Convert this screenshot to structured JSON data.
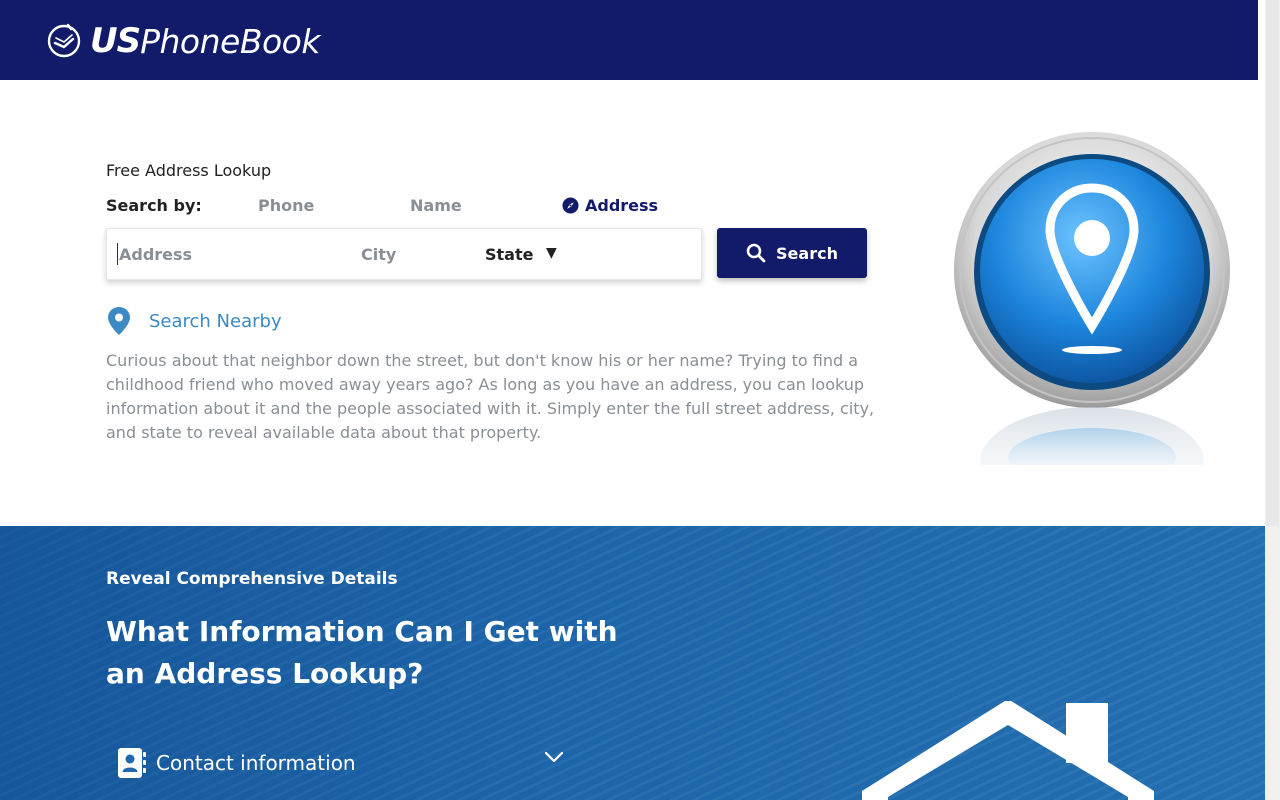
{
  "header": {
    "logo_bold": "US",
    "logo_regular": "PhoneBook"
  },
  "lookup": {
    "kicker": "Free Address Lookup",
    "search_by_label": "Search by:",
    "tabs": [
      {
        "label": "Phone",
        "active": false
      },
      {
        "label": "Name",
        "active": false
      },
      {
        "label": "Address",
        "active": true
      }
    ],
    "address_placeholder": "Address",
    "city_placeholder": "City",
    "state_label": "State",
    "search_button": "Search",
    "nearby_label": "Search Nearby",
    "description": "Curious about that neighbor down the street, but don't know his or her name? Trying to find a childhood friend who moved away years ago? As long as you have an address, you can lookup information about it and the people associated with it. Simply enter the full street address, city, and state to reveal available data about that property."
  },
  "details": {
    "kicker": "Reveal Comprehensive Details",
    "title": "What Information Can I Get with an Address Lookup?",
    "accordion": [
      {
        "label": "Contact information",
        "icon": "contact-card-icon"
      }
    ]
  },
  "colors": {
    "header_bg": "#121a6a",
    "accent_link": "#3b8ac4",
    "section_blue": "#1f6aae",
    "button_bg": "#121a6a"
  }
}
